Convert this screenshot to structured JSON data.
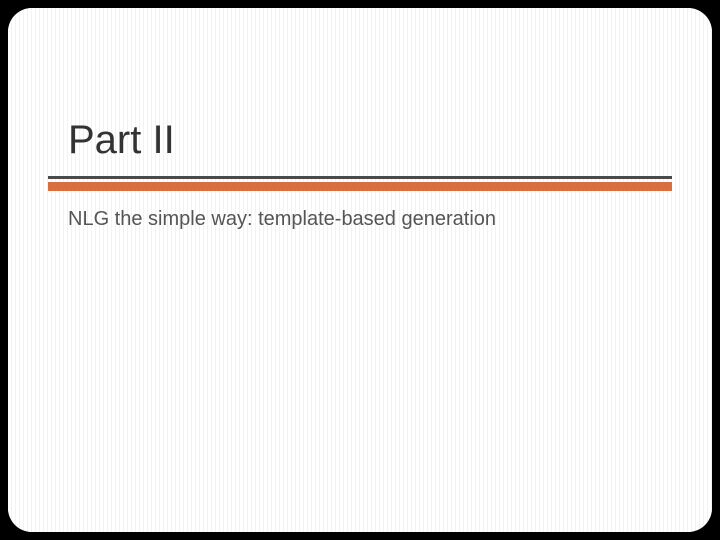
{
  "slide": {
    "title": "Part II",
    "subtitle": "NLG the simple way: template-based generation"
  },
  "colors": {
    "accent": "#d96f3e",
    "divider": "#4b4b4b"
  }
}
